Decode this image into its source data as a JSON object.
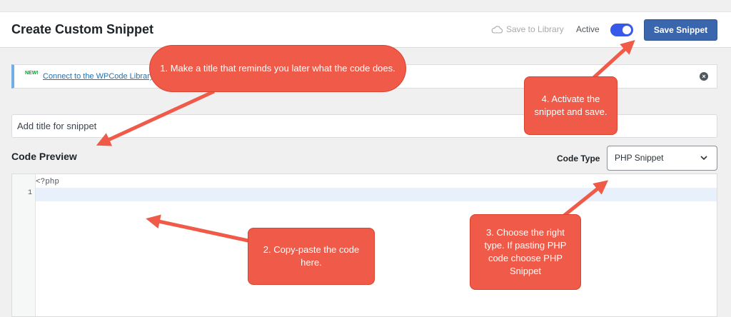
{
  "header": {
    "title": "Create Custom Snippet",
    "save_to_library": "Save to Library",
    "active_label": "Active",
    "active": true,
    "save_button": "Save Snippet"
  },
  "notice": {
    "badge": "NEW!",
    "link": "Connect to the WPCode Library"
  },
  "form": {
    "title_placeholder": "Add title for snippet",
    "code_preview_label": "Code Preview",
    "code_type_label": "Code Type",
    "code_type_value": "PHP Snippet"
  },
  "editor": {
    "first_line": "<?php",
    "line_number": "1"
  },
  "callouts": {
    "step1": "1. Make a title that reminds you later what the code does.",
    "step2": "2. Copy-paste the code here.",
    "step3": "3. Choose the right type. If pasting PHP code choose PHP Snippet",
    "step4": "4. Activate the snippet and save."
  },
  "colors": {
    "accent": "#3a66ad",
    "toggle": "#3858e9",
    "callout": "#f05a48",
    "new_badge": "#00a32a",
    "link": "#2271b1"
  }
}
